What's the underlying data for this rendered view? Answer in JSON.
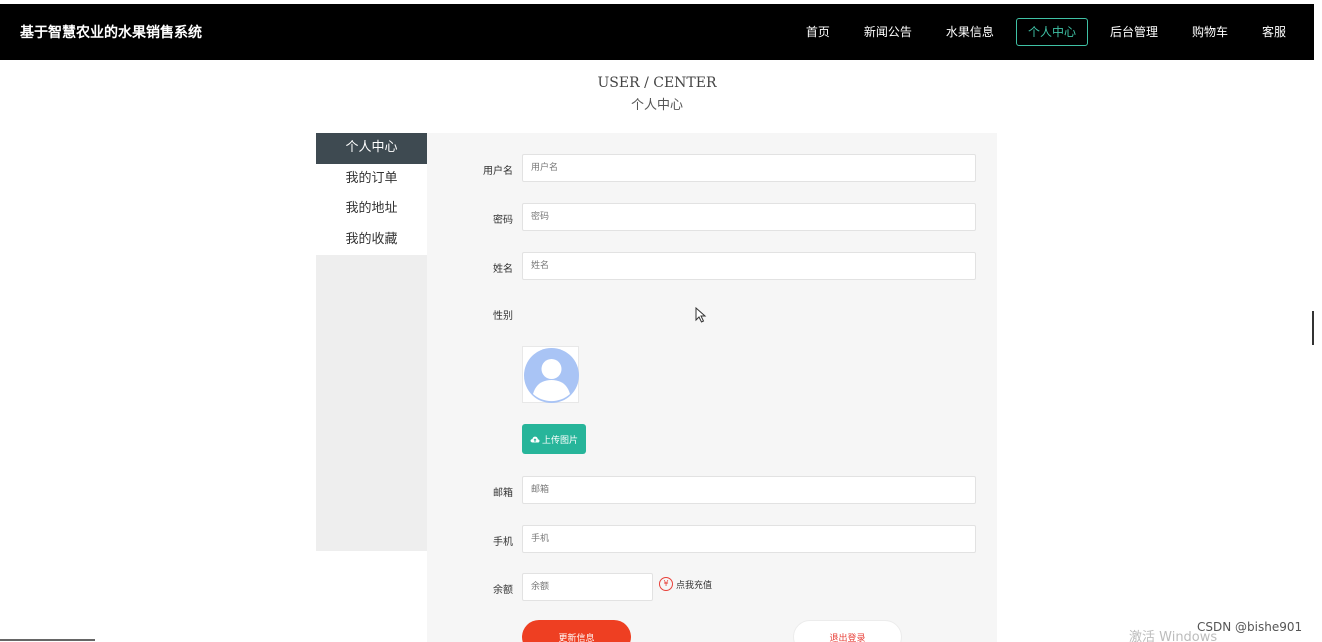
{
  "header": {
    "site_title": "基于智慧农业的水果销售系统",
    "nav": [
      {
        "label": "首页"
      },
      {
        "label": "新闻公告"
      },
      {
        "label": "水果信息"
      },
      {
        "label": "个人中心",
        "active": true
      },
      {
        "label": "后台管理"
      },
      {
        "label": "购物车"
      },
      {
        "label": "客服"
      }
    ]
  },
  "heading": {
    "en": "USER / CENTER",
    "cn": "个人中心"
  },
  "sidebar": {
    "items": [
      {
        "label": "个人中心",
        "active": true
      },
      {
        "label": "我的订单"
      },
      {
        "label": "我的地址"
      },
      {
        "label": "我的收藏"
      }
    ]
  },
  "form": {
    "username": {
      "label": "用户名",
      "placeholder": "用户名"
    },
    "password": {
      "label": "密码",
      "placeholder": "密码"
    },
    "name": {
      "label": "姓名",
      "placeholder": "姓名"
    },
    "gender": {
      "label": "性别"
    },
    "upload_label": "上传图片",
    "email": {
      "label": "邮箱",
      "placeholder": "邮箱"
    },
    "phone": {
      "label": "手机",
      "placeholder": "手机"
    },
    "balance": {
      "label": "余额",
      "placeholder": "余额"
    },
    "recharge_label": "点我充值",
    "recharge_icon_glyph": "¥",
    "update_label": "更新信息",
    "logout_label": "退出登录"
  },
  "watermark": {
    "windows": "激活 Windows",
    "csdn": "CSDN @bishe901"
  },
  "colors": {
    "nav_active": "#3fc1a5",
    "upload": "#27b59a",
    "update": "#ee3f22",
    "sidebar_active": "#3e4a51"
  }
}
